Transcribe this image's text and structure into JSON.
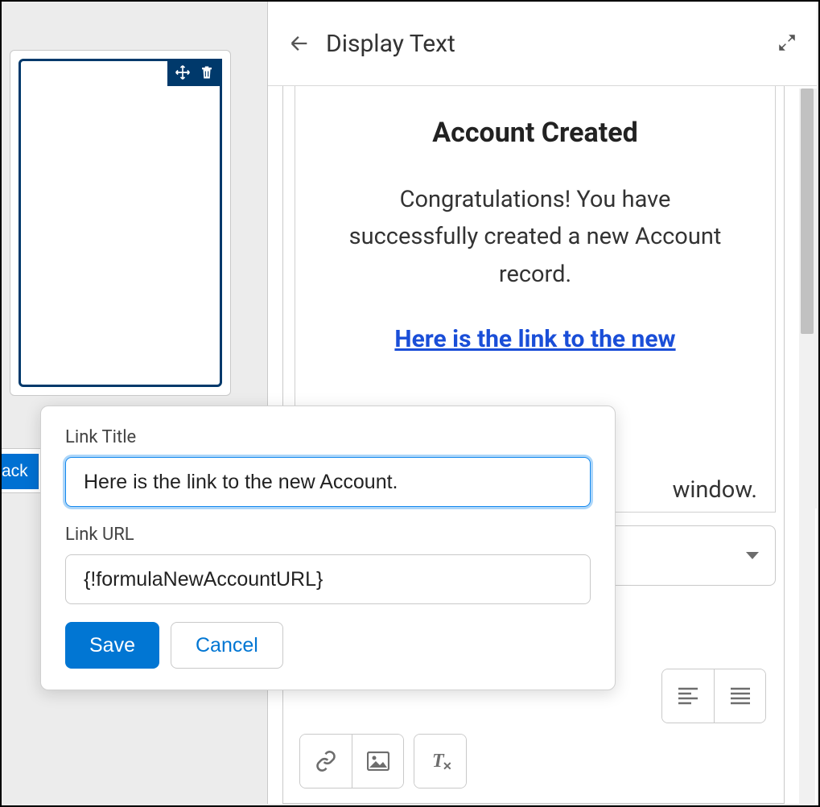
{
  "header": {
    "title": "Display Text"
  },
  "leftPane": {
    "backLabel": "ack"
  },
  "componentToolbar": {
    "moveIcon": "move",
    "deleteIcon": "delete"
  },
  "preview": {
    "heading": "Account Created",
    "body": "Congratulations! You have successfully created a new Account record.",
    "linkText": "Here is the link to the new ",
    "windowFragment": "window."
  },
  "linkPopover": {
    "titleLabel": "Link Title",
    "titleValue": "Here is the link to the new Account.",
    "urlLabel": "Link URL",
    "urlValue": "{!formulaNewAccountURL}",
    "saveLabel": "Save",
    "cancelLabel": "Cancel"
  }
}
